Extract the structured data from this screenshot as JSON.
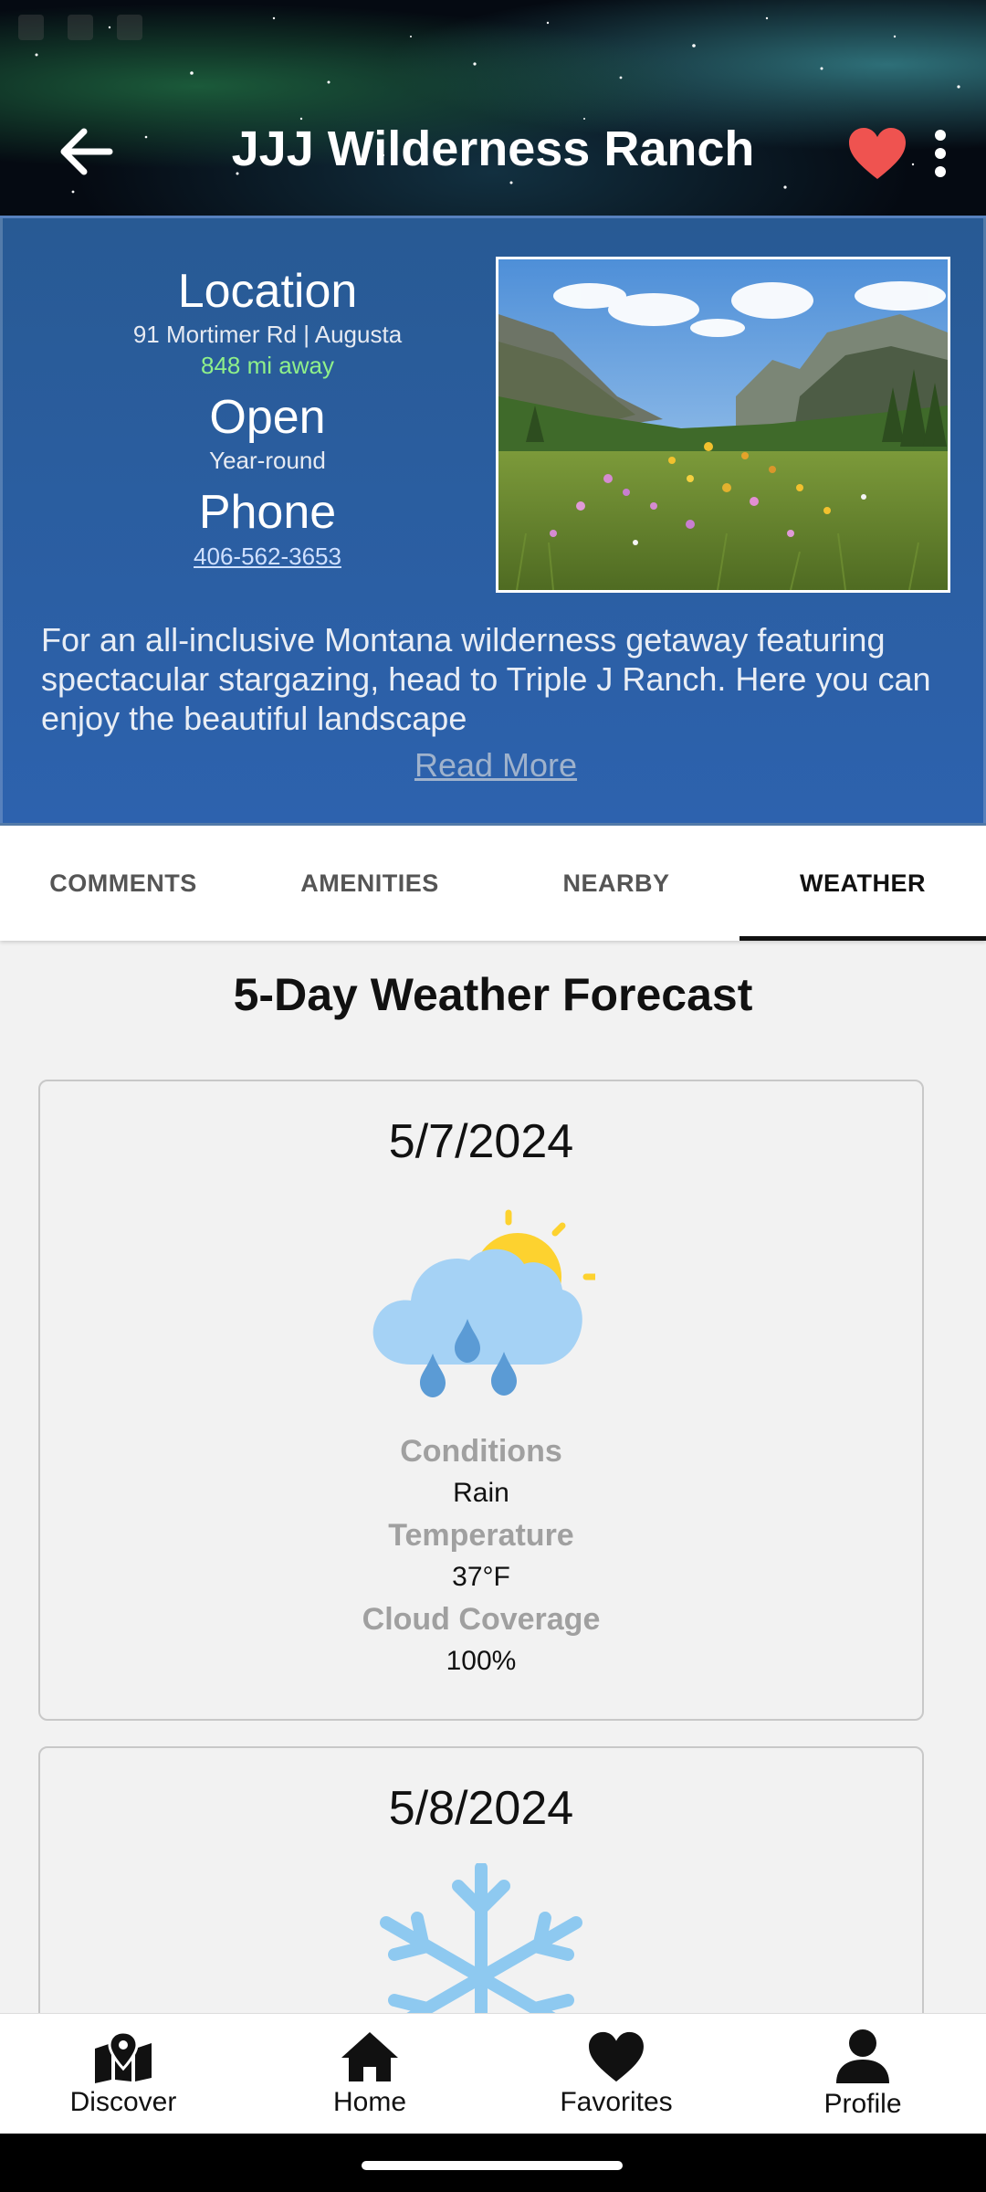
{
  "header": {
    "title": "JJJ Wilderness Ranch"
  },
  "info": {
    "location_heading": "Location",
    "address": "91 Mortimer Rd | Augusta",
    "distance": "848 mi away",
    "open_heading": "Open",
    "open_value": "Year-round",
    "phone_heading": "Phone",
    "phone_value": "406-562-3653",
    "description": "For an all-inclusive Montana wilderness getaway featuring spectacular stargazing, head to Triple J Ranch. Here you can enjoy the beautiful landscape",
    "read_more": "Read More"
  },
  "tabs": [
    "COMMENTS",
    "AMENITIES",
    "NEARBY",
    "WEATHER"
  ],
  "active_tab": "WEATHER",
  "forecast": {
    "title": "5-Day Weather Forecast",
    "days": [
      {
        "date": "5/7/2024",
        "icon": "rain-sun-icon",
        "conditions_label": "Conditions",
        "conditions": "Rain",
        "temperature_label": "Temperature",
        "temperature": "37°F",
        "cloud_label": "Cloud Coverage",
        "cloud": "100%"
      },
      {
        "date": "5/8/2024",
        "icon": "snowflake-icon"
      }
    ]
  },
  "bottom_nav": [
    "Discover",
    "Home",
    "Favorites",
    "Profile"
  ],
  "colors": {
    "panel": "#2d62ae",
    "heart": "#ef5350",
    "distance": "#8ff08a",
    "sun": "#fdd22f",
    "cloud": "#a5d2f5",
    "drops": "#5b9bd5",
    "snow": "#8ec9f0"
  }
}
